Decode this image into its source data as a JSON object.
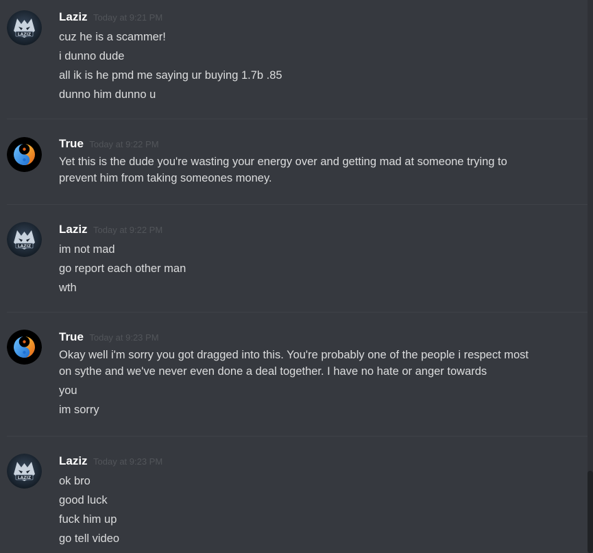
{
  "messages": [
    {
      "author": "Laziz",
      "avatar": "wolf-logo-avatar",
      "timestamp": "Today at 9:21 PM",
      "lines": [
        "cuz he is a scammer!",
        "i dunno dude",
        "all ik is he pmd me saying ur buying 1.7b .85",
        "dunno him dunno u"
      ]
    },
    {
      "author": "True",
      "avatar": "yin-yang-avatar",
      "timestamp": "Today at 9:22 PM",
      "lines": [
        "Yet this is the dude you're wasting your energy over and getting mad at someone trying to prevent him from taking someones money."
      ]
    },
    {
      "author": "Laziz",
      "avatar": "wolf-logo-avatar",
      "timestamp": "Today at 9:22 PM",
      "lines": [
        "im not mad",
        "go report each other man",
        "wth"
      ]
    },
    {
      "author": "True",
      "avatar": "yin-yang-avatar",
      "timestamp": "Today at 9:23 PM",
      "lines": [
        "Okay well i'm sorry you got dragged into this. You're probably one of the people i respect most on sythe and we've never even done a deal together. I have no hate or anger towards",
        "you",
        "im sorry"
      ]
    },
    {
      "author": "Laziz",
      "avatar": "wolf-logo-avatar",
      "timestamp": "Today at 9:23 PM",
      "lines": [
        "ok bro",
        "good luck",
        "fuck him up",
        "go tell video"
      ]
    }
  ],
  "colors": {
    "background": "#36393f",
    "username": "#ffffff",
    "timestamp": "#52555a",
    "message_text": "#dcddde",
    "separator": "#3f4248",
    "scrollbar_thumb": "#202225"
  }
}
